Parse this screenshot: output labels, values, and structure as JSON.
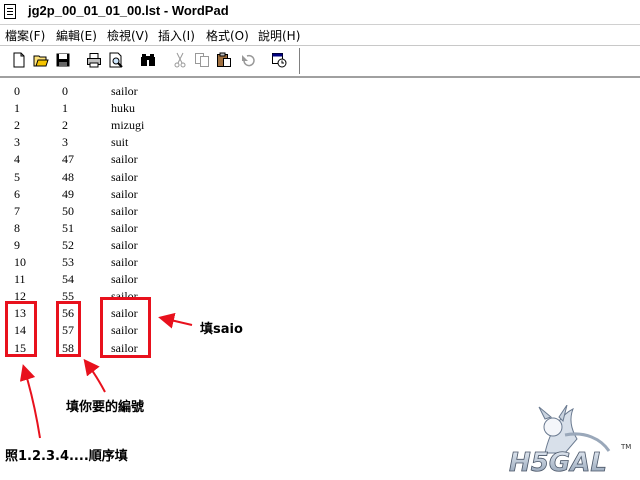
{
  "window": {
    "title": "jg2p_00_01_01_00.lst - WordPad"
  },
  "menu": [
    {
      "label": "檔案(F)"
    },
    {
      "label": "編輯(E)"
    },
    {
      "label": "檢視(V)"
    },
    {
      "label": "插入(I)"
    },
    {
      "label": "格式(O)"
    },
    {
      "label": "說明(H)"
    }
  ],
  "toolbar": {
    "buttons": [
      {
        "icon": "new-document-icon"
      },
      {
        "icon": "open-folder-icon"
      },
      {
        "icon": "save-disk-icon"
      },
      {
        "icon": "print-icon"
      },
      {
        "icon": "print-preview-icon"
      },
      {
        "icon": "find-binoculars-icon"
      },
      {
        "icon": "cut-scissors-icon"
      },
      {
        "icon": "copy-icon"
      },
      {
        "icon": "paste-clipboard-icon"
      },
      {
        "icon": "undo-icon"
      },
      {
        "icon": "insert-datetime-icon"
      }
    ]
  },
  "document": {
    "rows": [
      {
        "index": "0",
        "id": "0",
        "name": "sailor"
      },
      {
        "index": "1",
        "id": "1",
        "name": "huku"
      },
      {
        "index": "2",
        "id": "2",
        "name": "mizugi"
      },
      {
        "index": "3",
        "id": "3",
        "name": "suit"
      },
      {
        "index": "4",
        "id": "47",
        "name": "sailor"
      },
      {
        "index": "5",
        "id": "48",
        "name": "sailor"
      },
      {
        "index": "6",
        "id": "49",
        "name": "sailor"
      },
      {
        "index": "7",
        "id": "50",
        "name": "sailor"
      },
      {
        "index": "8",
        "id": "51",
        "name": "sailor"
      },
      {
        "index": "9",
        "id": "52",
        "name": "sailor"
      },
      {
        "index": "10",
        "id": "53",
        "name": "sailor"
      },
      {
        "index": "11",
        "id": "54",
        "name": "sailor"
      },
      {
        "index": "12",
        "id": "55",
        "name": "sailor"
      },
      {
        "index": "13",
        "id": "56",
        "name": "sailor"
      },
      {
        "index": "14",
        "id": "57",
        "name": "sailor"
      },
      {
        "index": "15",
        "id": "58",
        "name": "sailor"
      }
    ]
  },
  "annotations": {
    "fill_saio": "填saio",
    "fill_number": "填你要的編號",
    "fill_order": "照1.2.3.4....順序填",
    "highlight_color": "#e8111d"
  },
  "watermark": {
    "logo_text": "H5GAL",
    "tm": "TM"
  }
}
